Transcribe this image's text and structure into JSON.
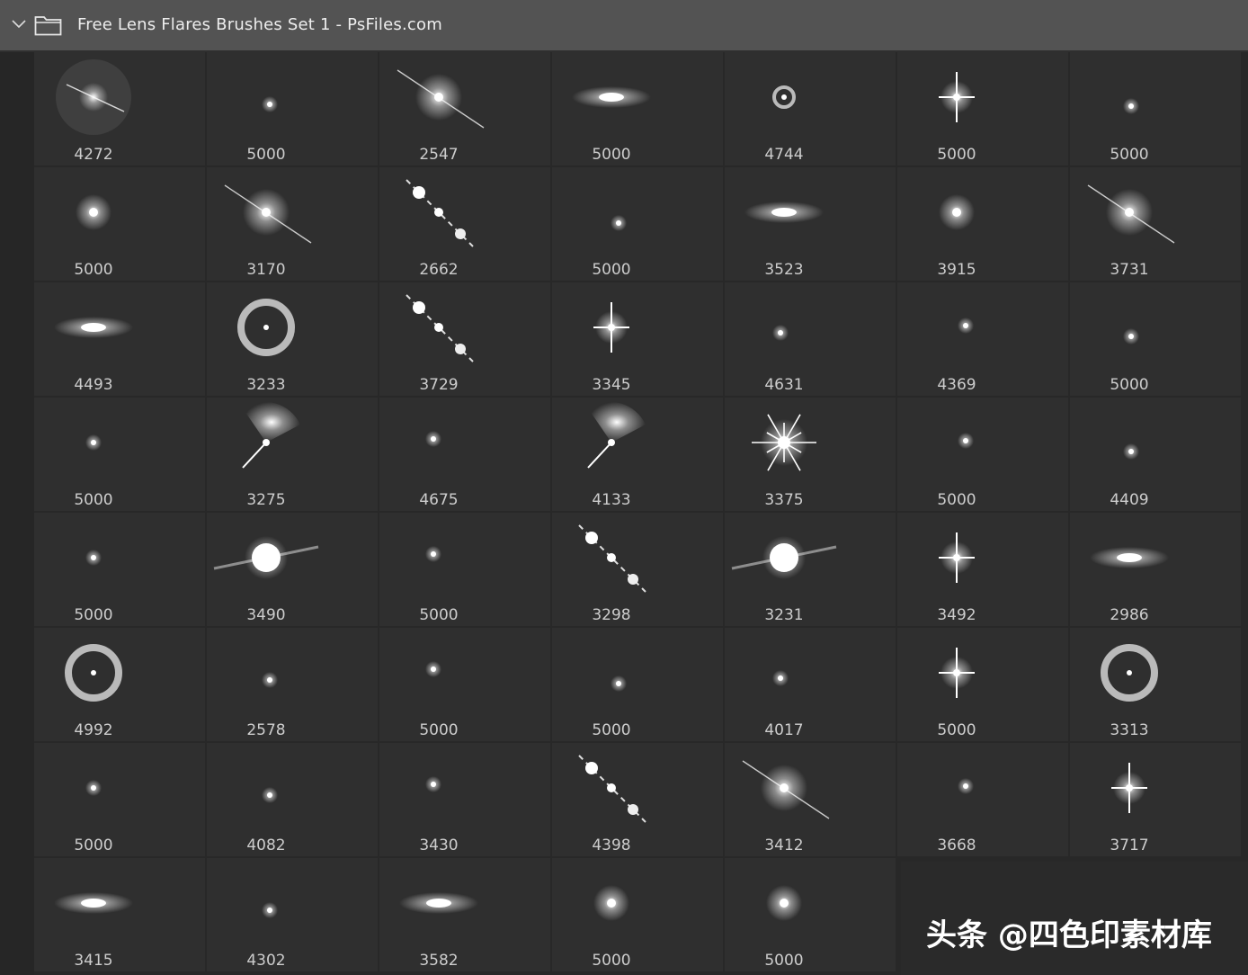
{
  "header": {
    "title": "Free Lens Flares Brushes Set 1 - PsFiles.com",
    "expand_icon": "chevron-down-icon",
    "folder_icon": "folder-icon"
  },
  "colors": {
    "header_bg": "#535353",
    "cell_bg": "#2f2f2f",
    "page_bg": "#282828",
    "label": "#cdcdcd",
    "flare": "#ffffff"
  },
  "brushes": [
    {
      "size": "4272",
      "kind": "halo"
    },
    {
      "size": "5000",
      "kind": "dot"
    },
    {
      "size": "2547",
      "kind": "streak"
    },
    {
      "size": "5000",
      "kind": "oval"
    },
    {
      "size": "4744",
      "kind": "ring"
    },
    {
      "size": "5000",
      "kind": "star"
    },
    {
      "size": "5000",
      "kind": "dot"
    },
    {
      "size": "5000",
      "kind": "glow"
    },
    {
      "size": "3170",
      "kind": "streak"
    },
    {
      "size": "2662",
      "kind": "chain"
    },
    {
      "size": "5000",
      "kind": "dot"
    },
    {
      "size": "3523",
      "kind": "oval"
    },
    {
      "size": "3915",
      "kind": "glow"
    },
    {
      "size": "3731",
      "kind": "streak"
    },
    {
      "size": "4493",
      "kind": "oval"
    },
    {
      "size": "3233",
      "kind": "ring"
    },
    {
      "size": "3729",
      "kind": "chain"
    },
    {
      "size": "3345",
      "kind": "star"
    },
    {
      "size": "4631",
      "kind": "dot"
    },
    {
      "size": "4369",
      "kind": "dot"
    },
    {
      "size": "5000",
      "kind": "dot"
    },
    {
      "size": "5000",
      "kind": "dot"
    },
    {
      "size": "3275",
      "kind": "fan"
    },
    {
      "size": "4675",
      "kind": "dot"
    },
    {
      "size": "4133",
      "kind": "fan"
    },
    {
      "size": "3375",
      "kind": "burst"
    },
    {
      "size": "5000",
      "kind": "dot"
    },
    {
      "size": "4409",
      "kind": "dot"
    },
    {
      "size": "5000",
      "kind": "dot"
    },
    {
      "size": "3490",
      "kind": "disc"
    },
    {
      "size": "5000",
      "kind": "dot"
    },
    {
      "size": "3298",
      "kind": "chain"
    },
    {
      "size": "3231",
      "kind": "disc"
    },
    {
      "size": "3492",
      "kind": "star"
    },
    {
      "size": "2986",
      "kind": "oval"
    },
    {
      "size": "4992",
      "kind": "ring"
    },
    {
      "size": "2578",
      "kind": "dot"
    },
    {
      "size": "5000",
      "kind": "dot"
    },
    {
      "size": "5000",
      "kind": "dot"
    },
    {
      "size": "4017",
      "kind": "dot"
    },
    {
      "size": "5000",
      "kind": "star"
    },
    {
      "size": "3313",
      "kind": "ring"
    },
    {
      "size": "5000",
      "kind": "dot"
    },
    {
      "size": "4082",
      "kind": "dot"
    },
    {
      "size": "3430",
      "kind": "dot"
    },
    {
      "size": "4398",
      "kind": "chain"
    },
    {
      "size": "3412",
      "kind": "streak"
    },
    {
      "size": "3668",
      "kind": "dot"
    },
    {
      "size": "3717",
      "kind": "star"
    },
    {
      "size": "3415",
      "kind": "oval"
    },
    {
      "size": "4302",
      "kind": "dot"
    },
    {
      "size": "3582",
      "kind": "oval"
    },
    {
      "size": "5000",
      "kind": "glow"
    },
    {
      "size": "5000",
      "kind": "glow"
    }
  ],
  "watermark": {
    "text": "头条 @四色印素材库"
  }
}
